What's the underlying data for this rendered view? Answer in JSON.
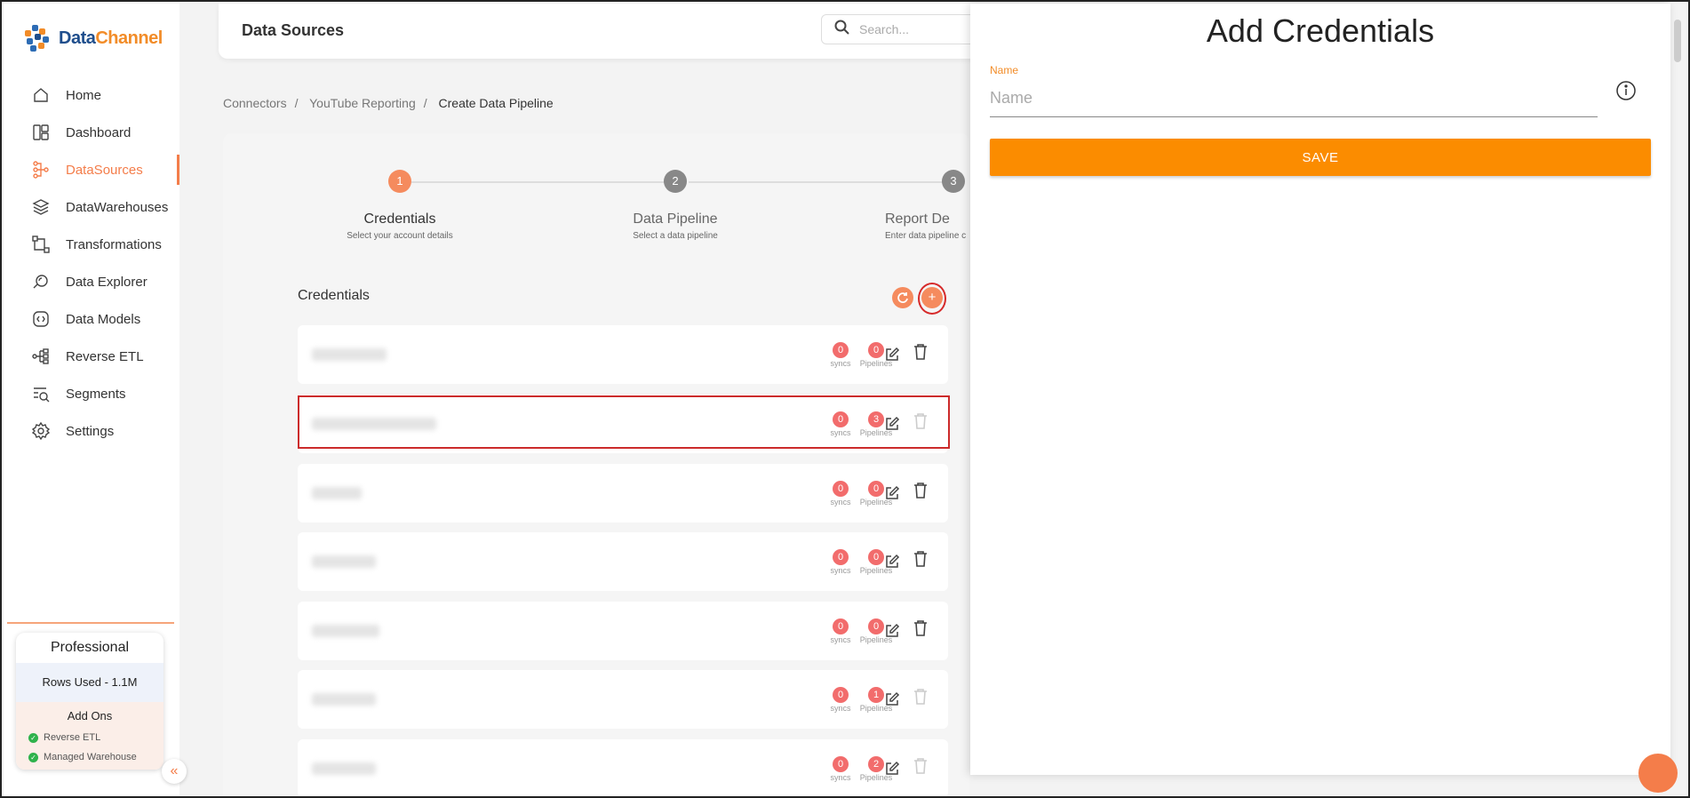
{
  "app": {
    "brand_a": "Data",
    "brand_b": "Channel"
  },
  "sidebar": {
    "items": [
      {
        "label": "Home",
        "icon": "home-icon"
      },
      {
        "label": "Dashboard",
        "icon": "dashboard-icon"
      },
      {
        "label": "DataSources",
        "icon": "datasources-icon",
        "active": true
      },
      {
        "label": "DataWarehouses",
        "icon": "layers-icon"
      },
      {
        "label": "Transformations",
        "icon": "transform-icon"
      },
      {
        "label": "Data Explorer",
        "icon": "explorer-icon"
      },
      {
        "label": "Data Models",
        "icon": "models-icon"
      },
      {
        "label": "Reverse ETL",
        "icon": "reverse-etl-icon"
      },
      {
        "label": "Segments",
        "icon": "segments-icon"
      },
      {
        "label": "Settings",
        "icon": "gear-icon"
      }
    ],
    "plan": {
      "title": "Professional",
      "rows_used": "Rows Used - 1.1M",
      "addons_title": "Add Ons",
      "addons": [
        "Reverse ETL",
        "Managed Warehouse"
      ]
    }
  },
  "header": {
    "title": "Data Sources",
    "search_placeholder": "Search..."
  },
  "breadcrumb": [
    "Connectors",
    "YouTube Reporting",
    "Create Data Pipeline"
  ],
  "stepper": [
    {
      "num": "1",
      "title": "Credentials",
      "sub": "Select your account details"
    },
    {
      "num": "2",
      "title": "Data Pipeline",
      "sub": "Select a data pipeline"
    },
    {
      "num": "3",
      "title": "Report De",
      "sub": "Enter data pipeline c"
    }
  ],
  "credentials": {
    "heading": "Credentials",
    "sync_label": "syncs",
    "pipeline_label": "Pipelines",
    "rows": [
      {
        "syncs": "0",
        "pipelines": "0"
      },
      {
        "syncs": "0",
        "pipelines": "3"
      },
      {
        "syncs": "0",
        "pipelines": "0"
      },
      {
        "syncs": "0",
        "pipelines": "0"
      },
      {
        "syncs": "0",
        "pipelines": "0"
      },
      {
        "syncs": "0",
        "pipelines": "1"
      },
      {
        "syncs": "0",
        "pipelines": "2"
      }
    ]
  },
  "drawer": {
    "title": "Add Credentials",
    "name_label": "Name",
    "name_placeholder": "Name",
    "save_label": "SAVE"
  },
  "colors": {
    "accent": "#f47d4a",
    "save": "#fb8c00",
    "badge": "#f26c6c"
  }
}
